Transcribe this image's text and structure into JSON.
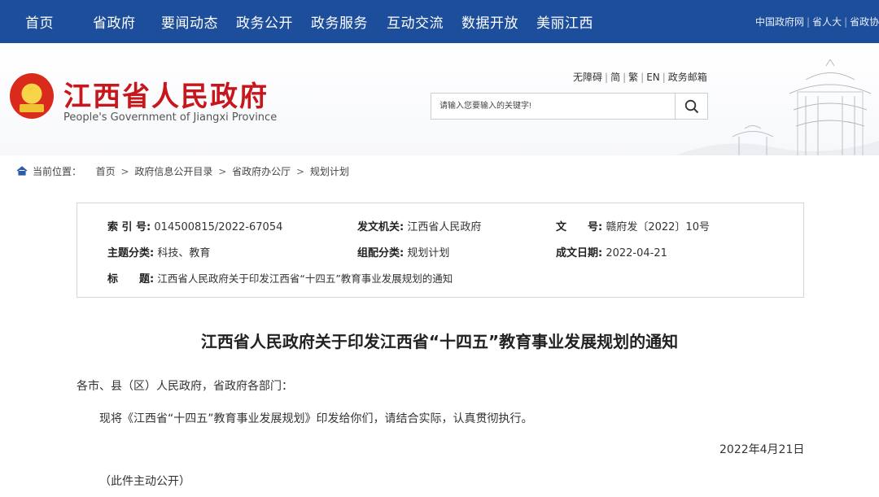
{
  "topnav": {
    "items": [
      "首页",
      "省政府",
      "要闻动态",
      "政务公开",
      "政务服务",
      "互动交流",
      "数据开放",
      "美丽江西"
    ],
    "right_links": [
      "中国政府网",
      "省人大",
      "省政协"
    ]
  },
  "header": {
    "title_cn": "江西省人民政府",
    "title_en": "People's Government of Jiangxi Province",
    "util_links": [
      "无障碍",
      "简",
      "繁",
      "EN",
      "政务邮箱"
    ],
    "search_placeholder": "请输入您要输入的关键字!"
  },
  "breadcrumb": {
    "label": "当前位置：",
    "items": [
      "首页",
      "政府信息公开目录",
      "省政府办公厅",
      "规划计划"
    ]
  },
  "info": {
    "index_label": "索 引 号:",
    "index_value": "014500815/2022-67054",
    "issuer_label": "发文机关:",
    "issuer_value": "江西省人民政府",
    "docno_label": "文　　号:",
    "docno_value": "赣府发〔2022〕10号",
    "topic_label": "主题分类:",
    "topic_value": "科技、教育",
    "category_label": "组配分类:",
    "category_value": "规划计划",
    "date_label": "成文日期:",
    "date_value": "2022-04-21",
    "title_label": "标　　题:",
    "title_value": "江西省人民政府关于印发江西省“十四五”教育事业发展规划的通知"
  },
  "article": {
    "title": "江西省人民政府关于印发江西省“十四五”教育事业发展规划的通知",
    "salutation": "各市、县（区）人民政府，省政府各部门：",
    "body": "现将《江西省“十四五”教育事业发展规划》印发给你们，请结合实际，认真贯彻执行。",
    "date": "2022年4月21日",
    "note": "（此件主动公开）"
  },
  "colors": {
    "nav_bg": "#1d4e9b",
    "brand_red": "#c8161d"
  }
}
